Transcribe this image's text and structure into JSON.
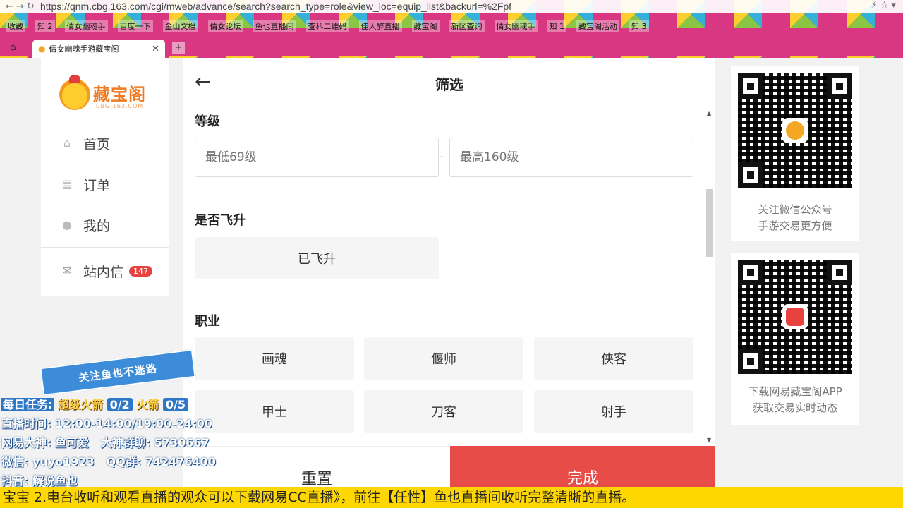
{
  "browser": {
    "url": "https://qnm.cbg.163.com/cgi/mweb/advance/search?search_type=role&view_loc=equip_list&backurl=%2Fpf",
    "bookmarks": [
      "收藏",
      "知 2",
      "倩女幽魂手",
      "百度一下",
      "金山文档",
      "倩女论坛",
      "鱼也直播间",
      "查科二维码",
      "佳人醉直播",
      "藏宝阁",
      "新区查询",
      "倩女幽魂手",
      "知 1",
      "藏宝阁活动",
      "知 3"
    ],
    "tab_title": "倩女幽魂手游藏宝阁"
  },
  "sidebar": {
    "logo_name": "藏宝阁",
    "logo_sub": "CBG.163.COM",
    "items": [
      {
        "label": "首页",
        "icon": "home-icon"
      },
      {
        "label": "订单",
        "icon": "order-icon"
      },
      {
        "label": "我的",
        "icon": "user-icon"
      },
      {
        "label": "站内信",
        "icon": "mail-icon",
        "badge": "147"
      }
    ]
  },
  "panel": {
    "title": "筛选",
    "level": {
      "label": "等级",
      "min_placeholder": "最低69级",
      "max_placeholder": "最高160级",
      "dash": "-"
    },
    "flight": {
      "label": "是否飞升",
      "option": "已飞升"
    },
    "class": {
      "label": "职业",
      "options": [
        "画魂",
        "偃师",
        "侠客",
        "甲士",
        "刀客",
        "射手"
      ]
    },
    "reset_label": "重置",
    "done_label": "完成"
  },
  "qr": [
    {
      "line1": "关注微信公众号",
      "line2": "手游交易更方便"
    },
    {
      "line1": "下载网易藏宝阁APP",
      "line2": "获取交易实时动态"
    }
  ],
  "overlay": {
    "banner": "关注鱼也不迷路",
    "task_key": "每日任务:",
    "task_rocket1": "超级火箭",
    "task_rocket1_count": "0/2",
    "task_rocket2": "火箭",
    "task_rocket2_count": "0/5",
    "time_key": "直播时间:",
    "time_val": "12:00-14:00/19:00-24:00",
    "god_key": "网易大神:",
    "god_val": "鱼可爱",
    "group_key": "大神群聊:",
    "group_val": "5730667",
    "wechat_key": "微信:",
    "wechat_val": "yuyo1923",
    "qq_key": "QQ群:",
    "qq_val": "742476400",
    "douyin_key": "抖音:",
    "douyin_val": "解说鱼也",
    "ticker": "宝宝    2.电台收听和观看直播的观众可以下载网易CC直播》，前往【任性】鱼也直播间收听完整清晰的直播。"
  },
  "colors": {
    "accent_red": "#e84c48",
    "logo_orange": "#f07b22",
    "badge_red": "#e8423f",
    "overlay_blue": "#2f78c8",
    "overlay_yellow": "#ffd23f"
  }
}
